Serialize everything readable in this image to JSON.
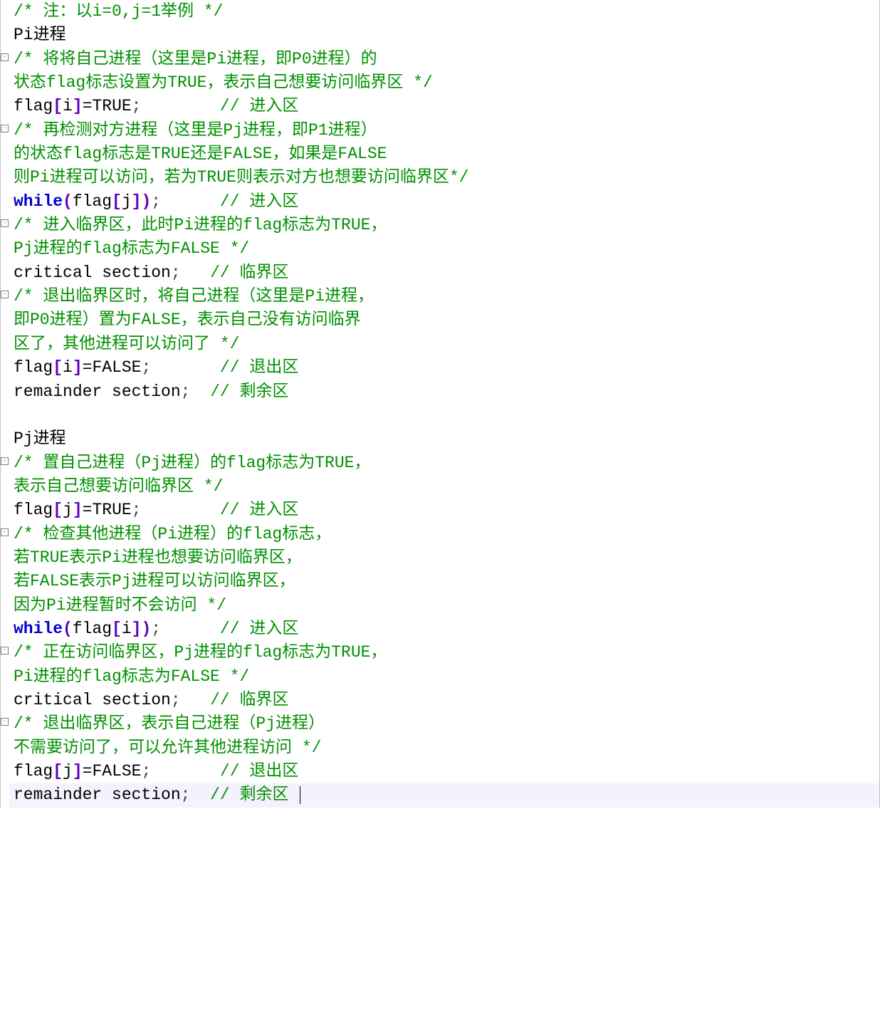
{
  "lines": [
    {
      "fold": false,
      "seg": [
        {
          "cls": "comment",
          "t": "/* 注：以i=0,j=1举例 */"
        }
      ]
    },
    {
      "fold": false,
      "seg": [
        {
          "cls": "plain",
          "t": "Pi进程"
        }
      ]
    },
    {
      "fold": true,
      "seg": [
        {
          "cls": "comment",
          "t": "/* 将将自己进程（这里是Pi进程，即P0进程）的"
        }
      ]
    },
    {
      "fold": false,
      "seg": [
        {
          "cls": "comment",
          "t": "状态flag标志设置为TRUE，表示自己想要访问临界区 */"
        }
      ]
    },
    {
      "fold": false,
      "seg": [
        {
          "cls": "plain",
          "t": "flag"
        },
        {
          "cls": "bracket",
          "t": "["
        },
        {
          "cls": "plain",
          "t": "i"
        },
        {
          "cls": "bracket",
          "t": "]"
        },
        {
          "cls": "plain",
          "t": "=TRUE"
        },
        {
          "cls": "punct",
          "t": ";"
        },
        {
          "cls": "plain",
          "t": "        "
        },
        {
          "cls": "comment",
          "t": "// 进入区"
        }
      ]
    },
    {
      "fold": true,
      "seg": [
        {
          "cls": "comment",
          "t": "/* 再检测对方进程（这里是Pj进程，即P1进程）"
        }
      ]
    },
    {
      "fold": false,
      "seg": [
        {
          "cls": "comment",
          "t": "的状态flag标志是TRUE还是FALSE，如果是FALSE"
        }
      ]
    },
    {
      "fold": false,
      "seg": [
        {
          "cls": "comment",
          "t": "则Pi进程可以访问，若为TRUE则表示对方也想要访问临界区*/"
        }
      ]
    },
    {
      "fold": false,
      "seg": [
        {
          "cls": "keyword",
          "t": "while"
        },
        {
          "cls": "bracket",
          "t": "("
        },
        {
          "cls": "plain",
          "t": "flag"
        },
        {
          "cls": "bracket",
          "t": "["
        },
        {
          "cls": "plain",
          "t": "j"
        },
        {
          "cls": "bracket",
          "t": "])"
        },
        {
          "cls": "punct",
          "t": ";"
        },
        {
          "cls": "plain",
          "t": "      "
        },
        {
          "cls": "comment",
          "t": "// 进入区"
        }
      ]
    },
    {
      "fold": true,
      "seg": [
        {
          "cls": "comment",
          "t": "/* 进入临界区，此时Pi进程的flag标志为TRUE，"
        }
      ]
    },
    {
      "fold": false,
      "seg": [
        {
          "cls": "comment",
          "t": "Pj进程的flag标志为FALSE */"
        }
      ]
    },
    {
      "fold": false,
      "seg": [
        {
          "cls": "plain",
          "t": "critical section"
        },
        {
          "cls": "punct",
          "t": ";"
        },
        {
          "cls": "plain",
          "t": "   "
        },
        {
          "cls": "comment",
          "t": "// 临界区"
        }
      ]
    },
    {
      "fold": true,
      "seg": [
        {
          "cls": "comment",
          "t": "/* 退出临界区时，将自己进程（这里是Pi进程，"
        }
      ]
    },
    {
      "fold": false,
      "seg": [
        {
          "cls": "comment",
          "t": "即P0进程）置为FALSE，表示自己没有访问临界"
        }
      ]
    },
    {
      "fold": false,
      "seg": [
        {
          "cls": "comment",
          "t": "区了，其他进程可以访问了 */"
        }
      ]
    },
    {
      "fold": false,
      "seg": [
        {
          "cls": "plain",
          "t": "flag"
        },
        {
          "cls": "bracket",
          "t": "["
        },
        {
          "cls": "plain",
          "t": "i"
        },
        {
          "cls": "bracket",
          "t": "]"
        },
        {
          "cls": "plain",
          "t": "=FALSE"
        },
        {
          "cls": "punct",
          "t": ";"
        },
        {
          "cls": "plain",
          "t": "       "
        },
        {
          "cls": "comment",
          "t": "// 退出区"
        }
      ]
    },
    {
      "fold": false,
      "seg": [
        {
          "cls": "plain",
          "t": "remainder section"
        },
        {
          "cls": "punct",
          "t": ";"
        },
        {
          "cls": "plain",
          "t": "  "
        },
        {
          "cls": "comment",
          "t": "// 剩余区"
        }
      ]
    },
    {
      "fold": false,
      "seg": [
        {
          "cls": "plain",
          "t": " "
        }
      ]
    },
    {
      "fold": false,
      "seg": [
        {
          "cls": "plain",
          "t": "Pj进程"
        }
      ]
    },
    {
      "fold": true,
      "seg": [
        {
          "cls": "comment",
          "t": "/* 置自己进程（Pj进程）的flag标志为TRUE，"
        }
      ]
    },
    {
      "fold": false,
      "seg": [
        {
          "cls": "comment",
          "t": "表示自己想要访问临界区 */"
        }
      ]
    },
    {
      "fold": false,
      "seg": [
        {
          "cls": "plain",
          "t": "flag"
        },
        {
          "cls": "bracket",
          "t": "["
        },
        {
          "cls": "plain",
          "t": "j"
        },
        {
          "cls": "bracket",
          "t": "]"
        },
        {
          "cls": "plain",
          "t": "=TRUE"
        },
        {
          "cls": "punct",
          "t": ";"
        },
        {
          "cls": "plain",
          "t": "        "
        },
        {
          "cls": "comment",
          "t": "// 进入区"
        }
      ]
    },
    {
      "fold": true,
      "seg": [
        {
          "cls": "comment",
          "t": "/* 检查其他进程（Pi进程）的flag标志，"
        }
      ]
    },
    {
      "fold": false,
      "seg": [
        {
          "cls": "comment",
          "t": "若TRUE表示Pi进程也想要访问临界区，"
        }
      ]
    },
    {
      "fold": false,
      "seg": [
        {
          "cls": "comment",
          "t": "若FALSE表示Pj进程可以访问临界区，"
        }
      ]
    },
    {
      "fold": false,
      "seg": [
        {
          "cls": "comment",
          "t": "因为Pi进程暂时不会访问 */"
        }
      ]
    },
    {
      "fold": false,
      "seg": [
        {
          "cls": "keyword",
          "t": "while"
        },
        {
          "cls": "bracket",
          "t": "("
        },
        {
          "cls": "plain",
          "t": "flag"
        },
        {
          "cls": "bracket",
          "t": "["
        },
        {
          "cls": "plain",
          "t": "i"
        },
        {
          "cls": "bracket",
          "t": "])"
        },
        {
          "cls": "punct",
          "t": ";"
        },
        {
          "cls": "plain",
          "t": "      "
        },
        {
          "cls": "comment",
          "t": "// 进入区"
        }
      ]
    },
    {
      "fold": true,
      "seg": [
        {
          "cls": "comment",
          "t": "/* 正在访问临界区，Pj进程的flag标志为TRUE，"
        }
      ]
    },
    {
      "fold": false,
      "seg": [
        {
          "cls": "comment",
          "t": "Pi进程的flag标志为FALSE */"
        }
      ]
    },
    {
      "fold": false,
      "seg": [
        {
          "cls": "plain",
          "t": "critical section"
        },
        {
          "cls": "punct",
          "t": ";"
        },
        {
          "cls": "plain",
          "t": "   "
        },
        {
          "cls": "comment",
          "t": "// 临界区"
        }
      ]
    },
    {
      "fold": true,
      "seg": [
        {
          "cls": "comment",
          "t": "/* 退出临界区，表示自己进程（Pj进程）"
        }
      ]
    },
    {
      "fold": false,
      "seg": [
        {
          "cls": "comment",
          "t": "不需要访问了，可以允许其他进程访问 */"
        }
      ]
    },
    {
      "fold": false,
      "seg": [
        {
          "cls": "plain",
          "t": "flag"
        },
        {
          "cls": "bracket",
          "t": "["
        },
        {
          "cls": "plain",
          "t": "j"
        },
        {
          "cls": "bracket",
          "t": "]"
        },
        {
          "cls": "plain",
          "t": "=FALSE"
        },
        {
          "cls": "punct",
          "t": ";"
        },
        {
          "cls": "plain",
          "t": "       "
        },
        {
          "cls": "comment",
          "t": "// 退出区"
        }
      ]
    },
    {
      "fold": false,
      "highlight": true,
      "caret": true,
      "seg": [
        {
          "cls": "plain",
          "t": "remainder section"
        },
        {
          "cls": "punct",
          "t": ";"
        },
        {
          "cls": "plain",
          "t": "  "
        },
        {
          "cls": "comment",
          "t": "// 剩余区 "
        }
      ]
    }
  ],
  "fold_glyph": "-"
}
